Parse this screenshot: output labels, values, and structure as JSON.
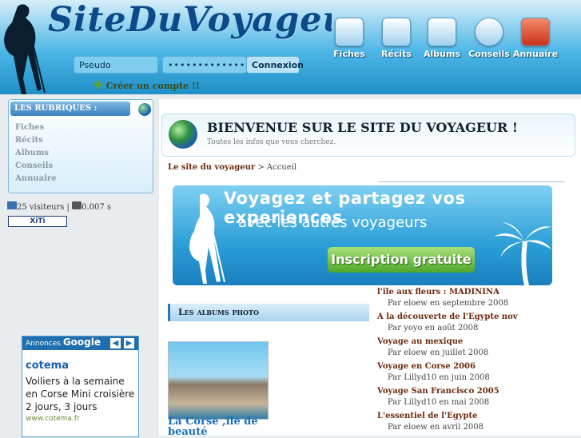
{
  "header": {
    "logo_text": "SiteDuVoyageur.com",
    "nav": [
      {
        "label": "Fiches",
        "icon": "fiches-icon"
      },
      {
        "label": "Récits",
        "icon": "recits-icon"
      },
      {
        "label": "Albums",
        "icon": "albums-icon"
      },
      {
        "label": "Conseils",
        "icon": "conseils-icon"
      },
      {
        "label": "Annuaire",
        "icon": "annuaire-icon"
      }
    ],
    "login": {
      "pseudo_value": "Pseudo",
      "password_value": "•••••••••••••",
      "button_label": "Connexion"
    },
    "create_account": "Créer un compte !!"
  },
  "sidebar": {
    "title": "LES RUBRIQUES :",
    "items": [
      "Fiches",
      "Récits",
      "Albums",
      "Conseils",
      "Annuaire"
    ],
    "visitors": "25 visiteurs",
    "time": "0.007 s",
    "xiti": "XiTi"
  },
  "ads": {
    "label": "Annonces",
    "brand": "Google",
    "title": "cotema",
    "text": "Voiliers à la semaine en Corse Mini croisière 2 jours, 3 jours",
    "url": "www.cotema.fr"
  },
  "main": {
    "welcome": "BIENVENUE SUR LE SITE DU VOYAGEUR !",
    "tagline": "Toutes les infos que vous cherchez.",
    "breadcrumb_link": "Le site du voyageur",
    "breadcrumb_current": " > Accueil",
    "banner_line1": "Voyagez et partagez vos experiences",
    "banner_line2": "avec les autres voyageurs",
    "banner_button": "Inscription gratuite",
    "albums_title": "Les albums photo",
    "photo_caption": "La Corse ,île de beauté",
    "albums": [
      {
        "title": "l'île aux fleurs : MADININA",
        "sub": "Par eloew en septembre 2008"
      },
      {
        "title": "A la découverte de l'Egypte nov",
        "sub": "Par yoyo en août 2008"
      },
      {
        "title": "Voyage au mexique",
        "sub": "Par eloew en juillet 2008"
      },
      {
        "title": "Voyage en Corse 2006",
        "sub": "Par Lillyd10 en juin 2008"
      },
      {
        "title": "Voyage San Francisco 2005",
        "sub": "Par Lillyd10 en mai 2008"
      },
      {
        "title": "L'essentiel de l'Egypte",
        "sub": "Par eloew en avril 2008"
      }
    ]
  }
}
